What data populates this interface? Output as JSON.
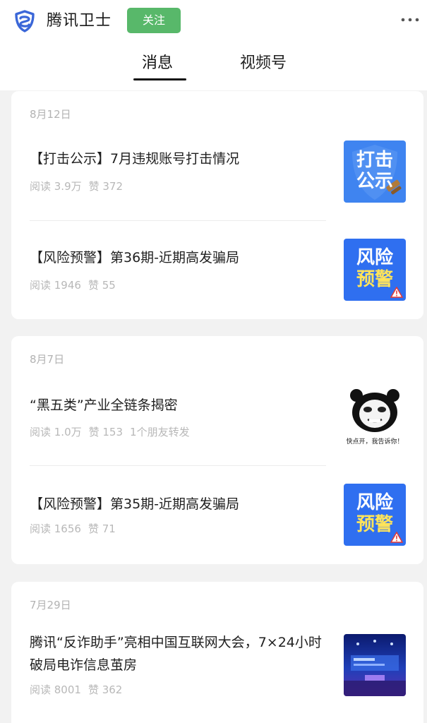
{
  "header": {
    "account_name": "腾讯卫士",
    "follow_label": "关注",
    "more_icon": "more-icon",
    "tabs": [
      {
        "label": "消息",
        "active": true
      },
      {
        "label": "视频号",
        "active": false
      }
    ]
  },
  "colors": {
    "follow_green": "#58b86a",
    "brand_blue": "#3b67d8",
    "thumb_blue": "#2f6ff0",
    "warning_yellow": "#ffe45a"
  },
  "groups": [
    {
      "date": "8月12日",
      "articles": [
        {
          "title": "【打击公示】7月违规账号打击情况",
          "reads": "阅读 3.9万",
          "likes": "赞 372",
          "thumb_icon": "crackdown-notice-thumbnail",
          "thumb_lines": [
            "打击",
            "公示"
          ]
        },
        {
          "title": "【风险预警】第36期-近期高发骗局",
          "reads": "阅读 1946",
          "likes": "赞 55",
          "thumb_icon": "risk-warning-thumbnail",
          "thumb_lines": [
            "风险",
            "预警"
          ]
        }
      ]
    },
    {
      "date": "8月7日",
      "articles": [
        {
          "title": "“黑五类”产业全链条揭密",
          "reads": "阅读 1.0万",
          "likes": "赞 153",
          "shares": "1个朋友转发",
          "thumb_icon": "panda-meme-thumbnail",
          "thumb_caption": "快点开，我告诉你！"
        },
        {
          "title": "【风险预警】第35期-近期高发骗局",
          "reads": "阅读 1656",
          "likes": "赞 71",
          "thumb_icon": "risk-warning-thumbnail",
          "thumb_lines": [
            "风险",
            "预警"
          ]
        }
      ]
    },
    {
      "date": "7月29日",
      "articles": [
        {
          "title": "腾讯“反诈助手”亮相中国互联网大会，7×24小时破局电诈信息茧房",
          "reads": "阅读 8001",
          "likes": "赞 362",
          "thumb_icon": "conference-stage-thumbnail"
        }
      ]
    }
  ]
}
